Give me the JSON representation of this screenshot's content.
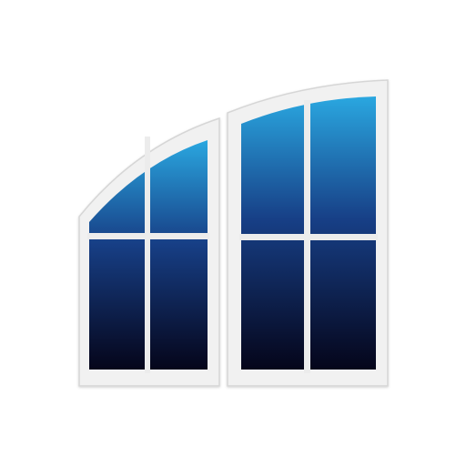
{
  "icon": {
    "name": "arched-window-icon",
    "colors": {
      "background": "#ffffff",
      "frame": "#f1f1f1",
      "frame_edge": "#d6d6d6",
      "mullion": "#ececec",
      "glass_top": "#2aa7e0",
      "glass_mid": "#173f86",
      "glass_bottom": "#05051a"
    }
  }
}
